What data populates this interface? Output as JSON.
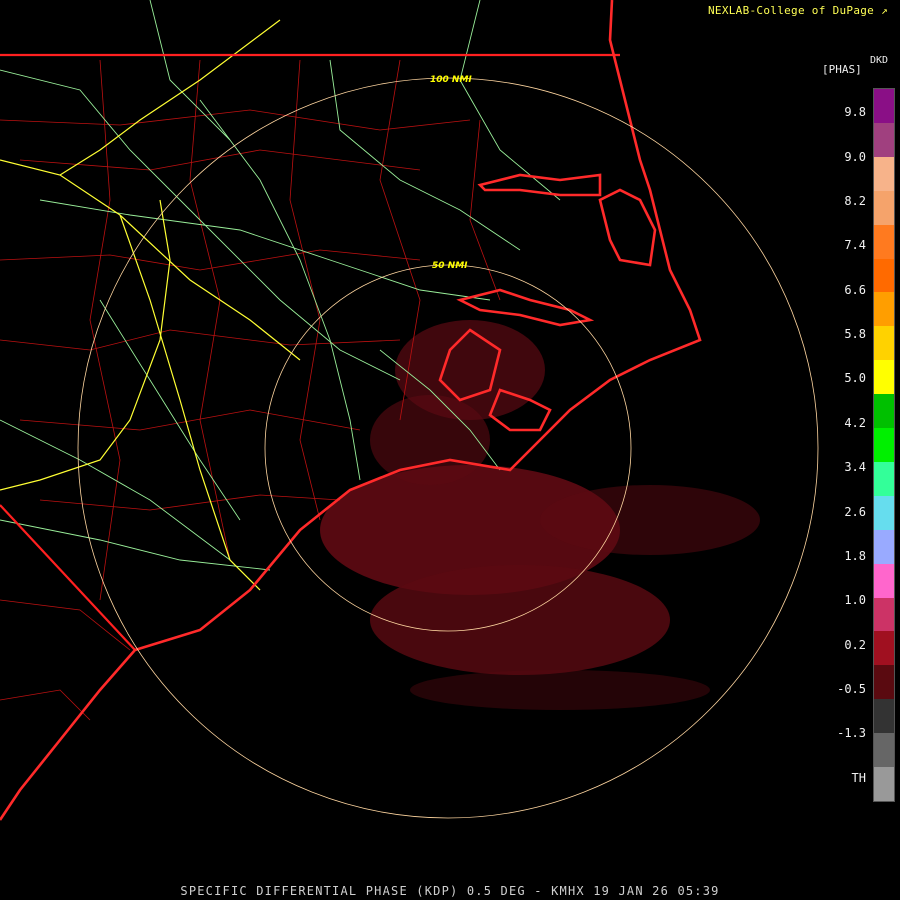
{
  "header": {
    "credit": "NEXLAB-College of DuPage",
    "credit_icon": "arrow-logo-icon"
  },
  "legend": {
    "product_code": "DKD",
    "units": "[PHAS]",
    "ticks": [
      "9.8",
      "9.0",
      "8.2",
      "7.4",
      "6.6",
      "5.8",
      "5.0",
      "4.2",
      "3.4",
      "2.6",
      "1.8",
      "1.0",
      "0.2",
      "-0.5",
      "-1.3",
      "TH"
    ],
    "colors": [
      "#8a0f86",
      "#a0407f",
      "#f7b38a",
      "#f5a36b",
      "#ff7a1f",
      "#ff6a00",
      "#ff9e00",
      "#ffd200",
      "#ffff00",
      "#00c000",
      "#00f000",
      "#33ff99",
      "#66ddee",
      "#99aaff",
      "#ff66cc",
      "#cc3366",
      "#a01020",
      "#5a0a10",
      "#333333",
      "#666666",
      "#999999"
    ]
  },
  "map": {
    "radar_site": "KMHX",
    "ring_labels": [
      "100 NMI",
      "50 NMI"
    ],
    "colors": {
      "state_lines": "#ff2020",
      "county_lines": "#cc1111",
      "highways": "#ffff44",
      "roads": "#99ff99",
      "rings": "#ffd6a0",
      "echo": "#5b0a12"
    }
  },
  "footer": {
    "caption": "SPECIFIC DIFFERENTIAL PHASE (KDP) 0.5 DEG - KMHX 19 JAN 26 05:39"
  }
}
